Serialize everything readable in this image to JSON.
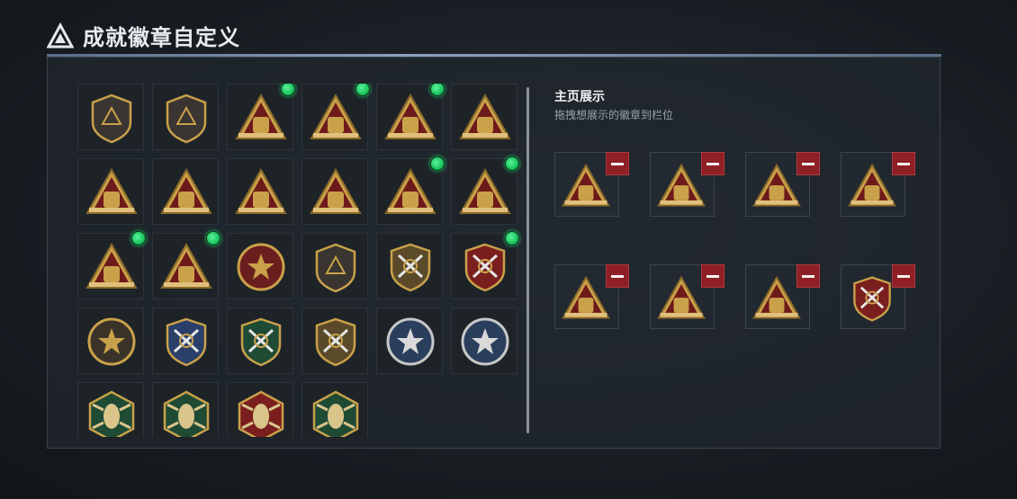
{
  "header": {
    "title": "成就徽章自定义"
  },
  "showcase": {
    "title": "主页展示",
    "subtitle": "拖拽想展示的徽章到栏位"
  },
  "badges": [
    {
      "icon": "shield-logo-badge-icon",
      "new": false
    },
    {
      "icon": "helicopter-shield-badge-icon",
      "new": false
    },
    {
      "icon": "sack-55-badge-icon",
      "new": true
    },
    {
      "icon": "crate-56-badge-icon",
      "new": true
    },
    {
      "icon": "case-57-badge-icon",
      "new": true
    },
    {
      "icon": "case-58-badge-icon",
      "new": false
    },
    {
      "icon": "sack-59-badge-icon",
      "new": false
    },
    {
      "icon": "hand-sign-badge-icon",
      "new": false
    },
    {
      "icon": "helmet-badge-icon",
      "new": false
    },
    {
      "icon": "number-one-badge-icon",
      "new": false
    },
    {
      "icon": "backpack-badge-icon",
      "new": true
    },
    {
      "icon": "treasure-badge-icon",
      "new": true
    },
    {
      "icon": "squad-badge-icon",
      "new": true
    },
    {
      "icon": "rocket-badge-icon",
      "new": true
    },
    {
      "icon": "round-star-badge-icon",
      "new": false
    },
    {
      "icon": "wing-shield-badge-icon",
      "new": false
    },
    {
      "icon": "star-crest-badge-icon",
      "new": false
    },
    {
      "icon": "red-star-crest-badge-icon",
      "new": true
    },
    {
      "icon": "skull-target-badge-icon",
      "new": false
    },
    {
      "icon": "blue-crossed-rifles-badge-icon",
      "new": false
    },
    {
      "icon": "green-crossed-rifles-badge-icon",
      "new": false
    },
    {
      "icon": "gold-crossed-rifles-badge-icon",
      "new": false
    },
    {
      "icon": "eagle-blue-badge-icon",
      "new": false
    },
    {
      "icon": "eagle-silver-badge-icon",
      "new": false
    },
    {
      "icon": "wasp-green-badge-icon",
      "new": false
    },
    {
      "icon": "wasp-green-2-badge-icon",
      "new": false
    },
    {
      "icon": "dragon-red-badge-icon",
      "new": false
    },
    {
      "icon": "wasp-gold-badge-icon",
      "new": false
    }
  ],
  "slots": [
    {
      "icon": "sack-55-badge-icon"
    },
    {
      "icon": "crate-56-badge-icon"
    },
    {
      "icon": "case-57-badge-icon"
    },
    {
      "icon": "treasure-badge-icon"
    },
    {
      "icon": "backpack-badge-icon"
    },
    {
      "icon": "squad-badge-icon"
    },
    {
      "icon": "rocket-badge-icon"
    },
    {
      "icon": "red-star-crest-badge-icon"
    }
  ],
  "colors": {
    "gold": "#c9a14a",
    "dark_red": "#6e1a1a",
    "new_dot": "#1ed760",
    "remove": "#8e1f25"
  }
}
